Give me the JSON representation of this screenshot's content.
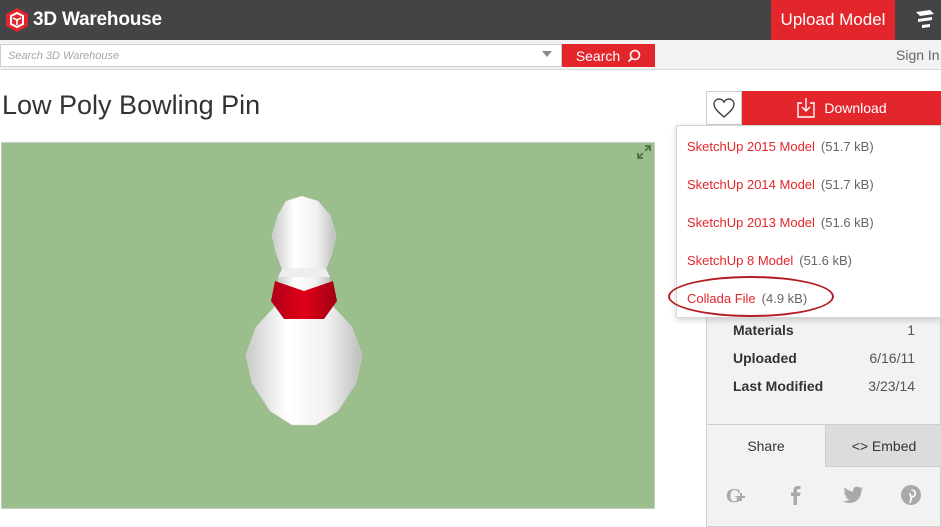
{
  "brand": {
    "name": "3D Warehouse",
    "accent": "#e3262c"
  },
  "topbar": {
    "upload_label": "Upload Model"
  },
  "search": {
    "placeholder": "Search 3D Warehouse",
    "button_label": "Search",
    "signin_label": "Sign In"
  },
  "model": {
    "title": "Low Poly Bowling Pin"
  },
  "actions": {
    "download_label": "Download"
  },
  "download_options": [
    {
      "name": "SketchUp 2015 Model",
      "size": "(51.7 kB)"
    },
    {
      "name": "SketchUp 2014 Model",
      "size": "(51.7 kB)"
    },
    {
      "name": "SketchUp 2013 Model",
      "size": "(51.6 kB)"
    },
    {
      "name": "SketchUp 8 Model",
      "size": "(51.6 kB)"
    },
    {
      "name": "Collada File",
      "size": "(4.9 kB)"
    }
  ],
  "info": {
    "rows": [
      {
        "key": "Materials",
        "value": "1"
      },
      {
        "key": "Uploaded",
        "value": "6/16/11"
      },
      {
        "key": "Last Modified",
        "value": "3/23/14"
      }
    ]
  },
  "share": {
    "tab_share": "Share",
    "tab_embed": "<> Embed",
    "icons": [
      "google-plus-icon",
      "facebook-icon",
      "twitter-icon",
      "pinterest-icon"
    ]
  }
}
